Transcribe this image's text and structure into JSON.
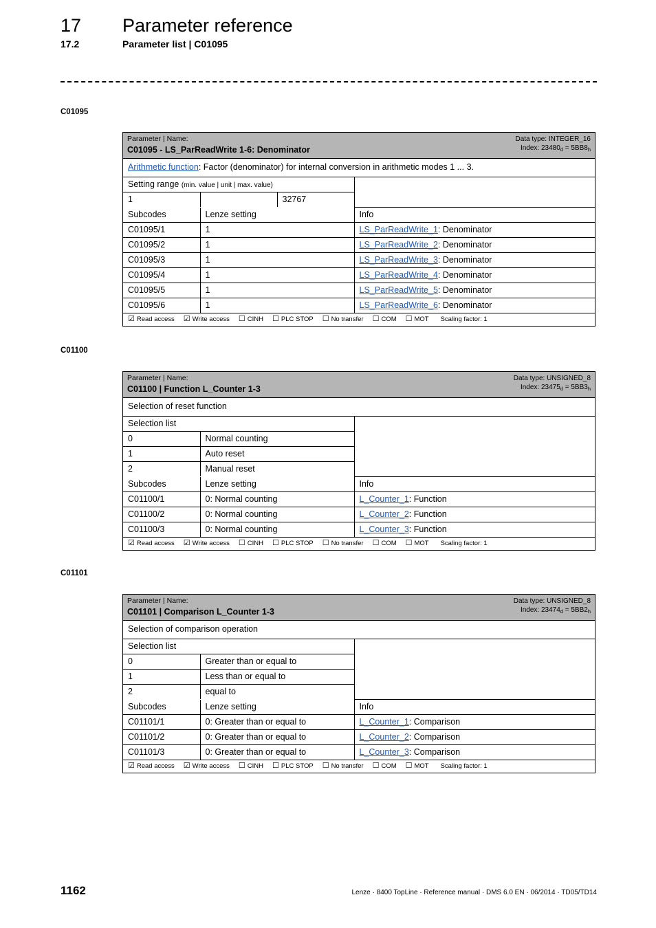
{
  "page": {
    "header": {
      "chapter_number": "17",
      "chapter_title": "Parameter reference",
      "section_number": "17.2",
      "section_title": "Parameter list | C01095"
    },
    "footer": {
      "page_number": "1162",
      "imprint": "Lenze · 8400 TopLine · Reference manual · DMS 6.0 EN · 06/2014 · TD05/TD14"
    },
    "colors": {
      "header_bar": "#b5b5b5",
      "subheader_row": "#d9d9d9",
      "link": "#1f5bbf"
    }
  },
  "access_legend": {
    "read": {
      "label": "Read access",
      "checked": true,
      "glyph": "☑"
    },
    "write": {
      "label": "Write access",
      "checked": true,
      "glyph": "☑"
    },
    "cinh": {
      "label": "CINH",
      "checked": false,
      "glyph": "☐"
    },
    "plc_stop": {
      "label": "PLC STOP",
      "checked": false,
      "glyph": "☐"
    },
    "no_transfer": {
      "label": "No transfer",
      "checked": false,
      "glyph": "☐"
    },
    "com": {
      "label": "COM",
      "checked": false,
      "glyph": "☐"
    },
    "mot": {
      "label": "MOT",
      "checked": false,
      "glyph": "☐"
    },
    "scaling": "Scaling factor: 1"
  },
  "blocks": [
    {
      "margin_label": "C01095",
      "header": {
        "kicker": "Parameter | Name:",
        "title": "C01095 - LS_ParReadWrite 1-6: Denominator",
        "data_type_line": "Data type: INTEGER_16",
        "index_prefix": "Index: ",
        "index_dec": "23480",
        "index_dec_sub": "d",
        "index_eq": " = ",
        "index_hex": "5BB8",
        "index_hex_sub": "h"
      },
      "description": {
        "link_text": "Arithmetic function",
        "rest": ": Factor (denominator) for internal conversion in arithmetic modes 1 ... 3."
      },
      "setting_range": {
        "title": "Setting range",
        "title_note": "(min. value | unit | max. value)",
        "min_value": "1",
        "unit": "",
        "max_value": "32767"
      },
      "subcodes_headers": [
        "Subcodes",
        "Lenze setting",
        "Info"
      ],
      "subcodes_rows": [
        {
          "subcode": "C01095/1",
          "lenze": "1",
          "info_link": "LS_ParReadWrite_1",
          "info_rest": ": Denominator"
        },
        {
          "subcode": "C01095/2",
          "lenze": "1",
          "info_link": "LS_ParReadWrite_2",
          "info_rest": ": Denominator"
        },
        {
          "subcode": "C01095/3",
          "lenze": "1",
          "info_link": "LS_ParReadWrite_3",
          "info_rest": ": Denominator"
        },
        {
          "subcode": "C01095/4",
          "lenze": "1",
          "info_link": "LS_ParReadWrite_4",
          "info_rest": ": Denominator"
        },
        {
          "subcode": "C01095/5",
          "lenze": "1",
          "info_link": "LS_ParReadWrite_5",
          "info_rest": ": Denominator"
        },
        {
          "subcode": "C01095/6",
          "lenze": "1",
          "info_link": "LS_ParReadWrite_6",
          "info_rest": ": Denominator"
        }
      ]
    },
    {
      "margin_label": "C01100",
      "header": {
        "kicker": "Parameter | Name:",
        "title": "C01100 | Function L_Counter 1-3",
        "data_type_line": "Data type: UNSIGNED_8",
        "index_prefix": "Index: ",
        "index_dec": "23475",
        "index_dec_sub": "d",
        "index_eq": " = ",
        "index_hex": "5BB3",
        "index_hex_sub": "h"
      },
      "description": {
        "link_text": "",
        "rest": "Selection of reset function"
      },
      "selection_list": {
        "title": "Selection list",
        "options": [
          {
            "value": "0",
            "label": "Normal counting"
          },
          {
            "value": "1",
            "label": "Auto reset"
          },
          {
            "value": "2",
            "label": "Manual reset"
          }
        ]
      },
      "subcodes_headers": [
        "Subcodes",
        "Lenze setting",
        "Info"
      ],
      "subcodes_rows": [
        {
          "subcode": "C01100/1",
          "lenze": "0: Normal counting",
          "info_link": "L_Counter_1",
          "info_rest": ": Function"
        },
        {
          "subcode": "C01100/2",
          "lenze": "0: Normal counting",
          "info_link": "L_Counter_2",
          "info_rest": ": Function"
        },
        {
          "subcode": "C01100/3",
          "lenze": "0: Normal counting",
          "info_link": "L_Counter_3",
          "info_rest": ": Function"
        }
      ]
    },
    {
      "margin_label": "C01101",
      "header": {
        "kicker": "Parameter | Name:",
        "title": "C01101 | Comparison L_Counter 1-3",
        "data_type_line": "Data type: UNSIGNED_8",
        "index_prefix": "Index: ",
        "index_dec": "23474",
        "index_dec_sub": "d",
        "index_eq": " = ",
        "index_hex": "5BB2",
        "index_hex_sub": "h"
      },
      "description": {
        "link_text": "",
        "rest": "Selection of comparison operation"
      },
      "selection_list": {
        "title": "Selection list",
        "options": [
          {
            "value": "0",
            "label": "Greater than or equal to"
          },
          {
            "value": "1",
            "label": "Less than or equal to"
          },
          {
            "value": "2",
            "label": "equal to"
          }
        ]
      },
      "subcodes_headers": [
        "Subcodes",
        "Lenze setting",
        "Info"
      ],
      "subcodes_rows": [
        {
          "subcode": "C01101/1",
          "lenze": "0: Greater than or equal to",
          "info_link": "L_Counter_1",
          "info_rest": ": Comparison"
        },
        {
          "subcode": "C01101/2",
          "lenze": "0: Greater than or equal to",
          "info_link": "L_Counter_2",
          "info_rest": ": Comparison"
        },
        {
          "subcode": "C01101/3",
          "lenze": "0: Greater than or equal to",
          "info_link": "L_Counter_3",
          "info_rest": ": Comparison"
        }
      ]
    }
  ]
}
